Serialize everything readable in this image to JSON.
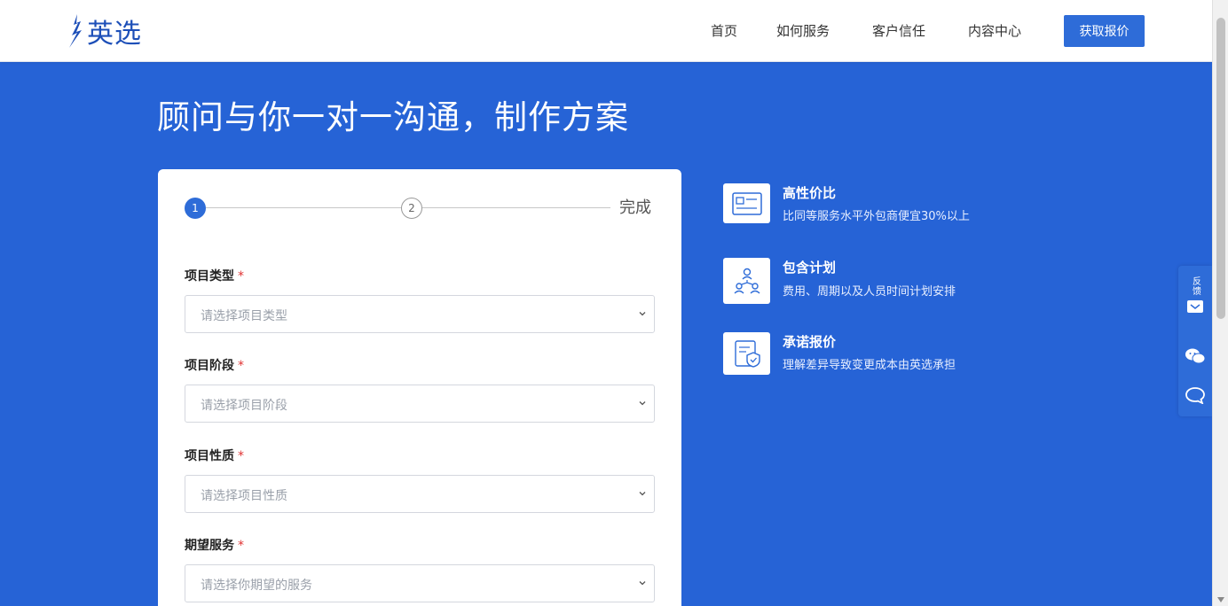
{
  "header": {
    "logo_text": "英选",
    "nav": [
      {
        "label": "首页"
      },
      {
        "label": "如何服务"
      },
      {
        "label": "客户信任"
      },
      {
        "label": "内容中心"
      }
    ],
    "cta_label": "获取报价"
  },
  "hero": {
    "title": "顾问与你一对一沟通，制作方案"
  },
  "form": {
    "steps": [
      {
        "label": "1",
        "state": "active"
      },
      {
        "label": "2",
        "state": "idle"
      }
    ],
    "done_label": "完成",
    "required_mark": "*",
    "fields": [
      {
        "label": "项目类型",
        "placeholder": "请选择项目类型"
      },
      {
        "label": "项目阶段",
        "placeholder": "请选择项目阶段"
      },
      {
        "label": "项目性质",
        "placeholder": "请选择项目性质"
      },
      {
        "label": "期望服务",
        "placeholder": "请选择你期望的服务"
      }
    ]
  },
  "features": [
    {
      "title": "高性价比",
      "desc": "比同等服务水平外包商便宜30%以上",
      "icon": "price-tag-icon"
    },
    {
      "title": "包含计划",
      "desc": "费用、周期以及人员时间计划安排",
      "icon": "team-plan-icon"
    },
    {
      "title": "承诺报价",
      "desc": "理解差异导致变更成本由英选承担",
      "icon": "shield-document-icon"
    }
  ],
  "side_toolbar": {
    "items": [
      {
        "label": "反馈",
        "icon": "feedback-icon"
      },
      {
        "label": "",
        "icon": "wechat-icon"
      },
      {
        "label": "",
        "icon": "chat-bubble-icon"
      }
    ]
  },
  "colors": {
    "brand": "#2663d6",
    "button": "#2e6cd8",
    "required": "#e03333"
  }
}
